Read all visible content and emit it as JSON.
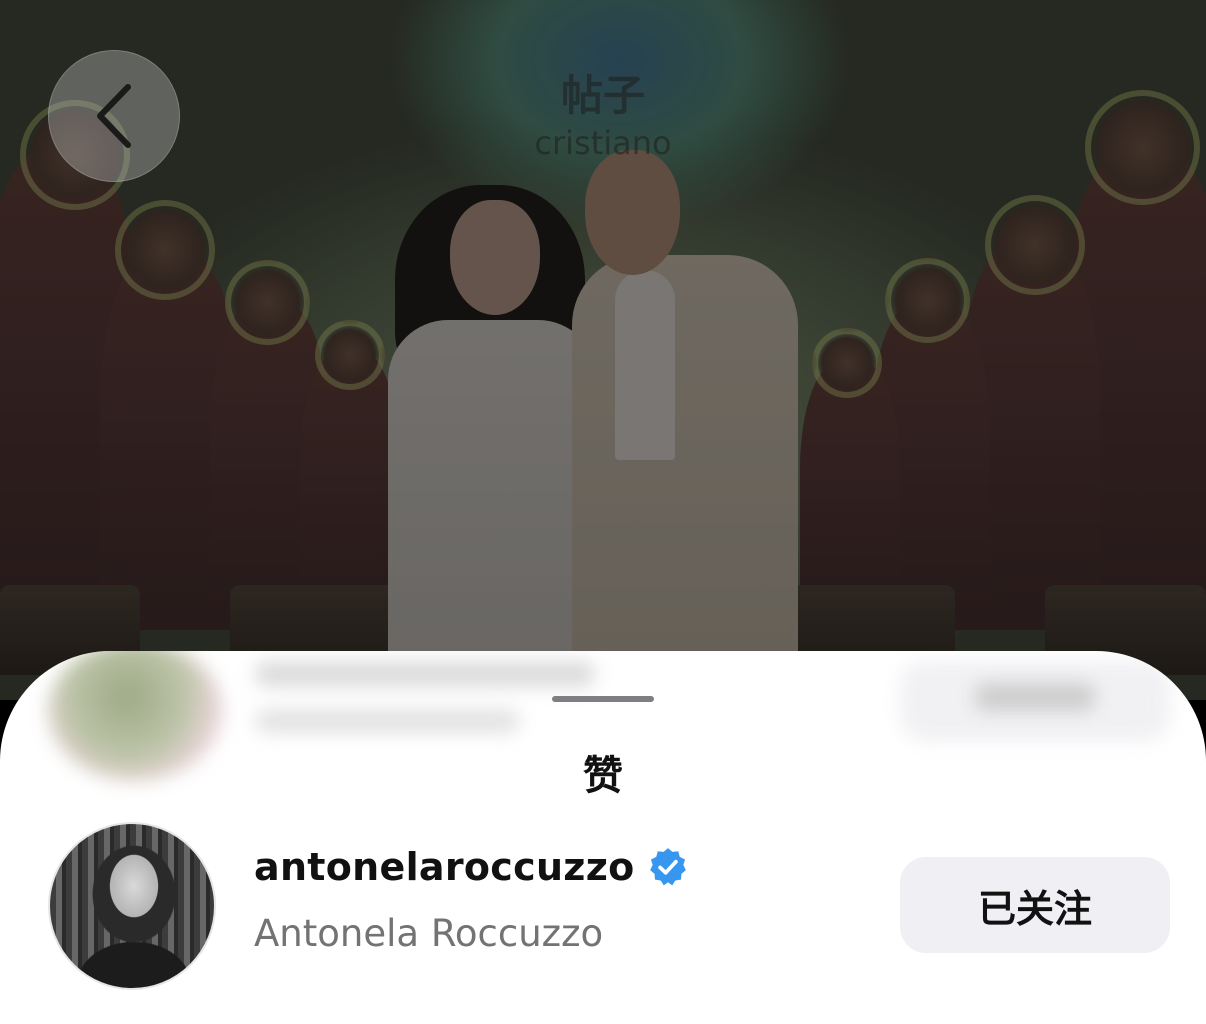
{
  "header": {
    "title": "帖子",
    "subtitle": "cristiano"
  },
  "sheet": {
    "title": "赞"
  },
  "likers": [
    {
      "username": "antonelaroccuzzo",
      "full_name": "Antonela Roccuzzo",
      "verified": true,
      "follow_label": "已关注"
    }
  ],
  "colors": {
    "verified_blue": "#3797f0",
    "follow_button_bg": "#efeff4",
    "sheet_bg": "#ffffff"
  },
  "icons": {
    "back": "chevron-left-icon",
    "verified": "verified-badge-icon"
  }
}
